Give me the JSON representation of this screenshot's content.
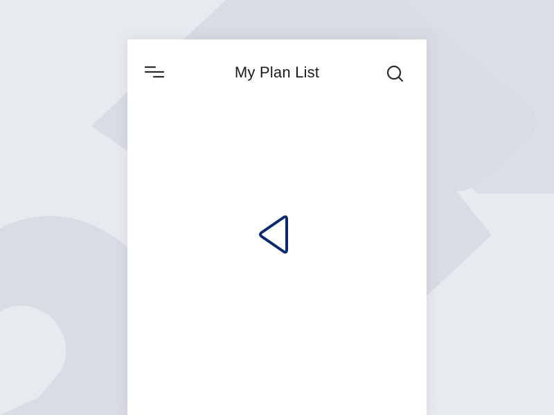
{
  "header": {
    "title": "My Plan List",
    "menu_icon": "menu-icon",
    "search_icon": "search-icon"
  },
  "content": {
    "center_icon": "triangle-left-icon",
    "icon_color": "#0d2a6e"
  },
  "colors": {
    "background": "#e8ebee",
    "background_shape": "#d9dce4",
    "card": "#ffffff",
    "title_text": "#1a1a1a",
    "icon_dark": "#2a2a2a",
    "accent": "#0d2a6e"
  }
}
